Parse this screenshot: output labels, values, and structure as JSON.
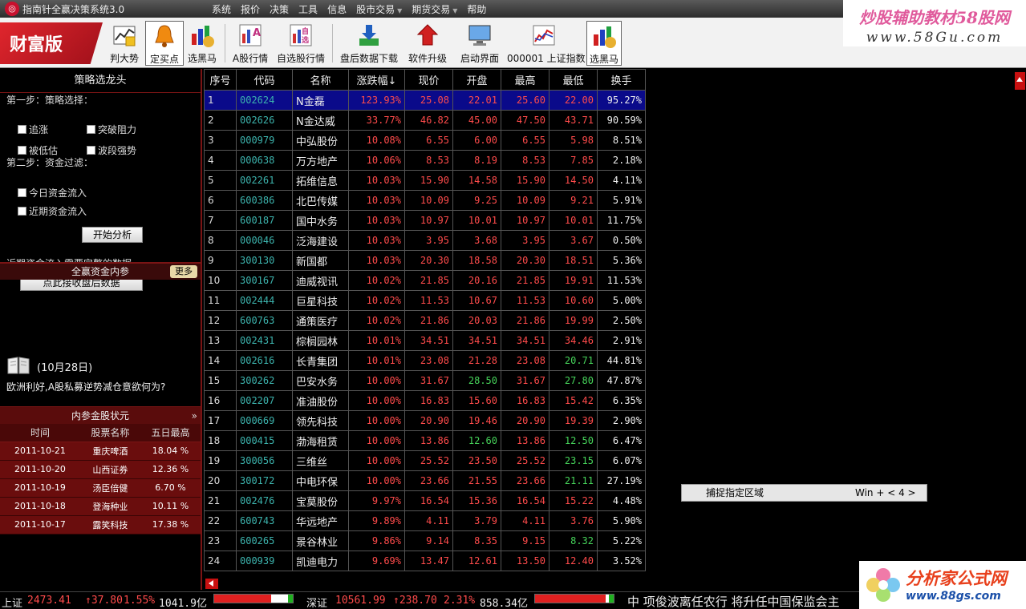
{
  "app": {
    "title": "指南针全赢决策系统3.0"
  },
  "menu": [
    {
      "label": "系统",
      "dropdown": false
    },
    {
      "label": "报价",
      "dropdown": false
    },
    {
      "label": "决策",
      "dropdown": false
    },
    {
      "label": "工具",
      "dropdown": false
    },
    {
      "label": "信息",
      "dropdown": false
    },
    {
      "label": "股市交易",
      "dropdown": true
    },
    {
      "label": "期货交易",
      "dropdown": true
    },
    {
      "label": "帮助",
      "dropdown": false
    }
  ],
  "watermark": {
    "line1": "炒股辅助教材58股网",
    "line2": "www.58Gu.com"
  },
  "edition": "财富版",
  "toolbar": [
    {
      "label": "判大势",
      "icon": "trend-icon",
      "active": false
    },
    {
      "label": "定买点",
      "icon": "bell-icon",
      "active": true
    },
    {
      "label": "选黑马",
      "icon": "bar-bag-icon",
      "active": false
    },
    {
      "label": "A股行情",
      "icon": "a-chart-icon",
      "active": false
    },
    {
      "label": "自选股行情",
      "icon": "custom-chart-icon",
      "active": false
    },
    {
      "label": "盘后数据下载",
      "icon": "download-icon",
      "active": false
    },
    {
      "label": "软件升级",
      "icon": "upgrade-icon",
      "active": false
    },
    {
      "label": "启动界面",
      "icon": "monitor-icon",
      "active": false
    },
    {
      "label": "000001 上证指数",
      "icon": "index-chart-icon",
      "active": false
    },
    {
      "label": "选黑马",
      "icon": "bar-bag-icon",
      "active": false
    }
  ],
  "strategy": {
    "title": "策略选龙头",
    "step1": "第一步：策略选择：",
    "options1": [
      "追涨",
      "突破阻力",
      "被低估",
      "波段强势"
    ],
    "step2": "第二步：资金过滤：",
    "options2": [
      "今日资金流入",
      "近期资金流入"
    ],
    "start_button": "开始分析",
    "note": "近期资金流入需要完整的数据",
    "receive_button": "点此接收盘后数据"
  },
  "insider": {
    "title": "全赢资金内参",
    "more": "更多",
    "date": "(10月28日)",
    "headline": "欧洲利好,A股私募逆势减仓意欲何为?"
  },
  "gold_stocks": {
    "title": "内参金股状元",
    "columns": [
      "时间",
      "股票名称",
      "五日最高"
    ],
    "rows": [
      [
        "2011-10-21",
        "重庆啤酒",
        "18.04 %"
      ],
      [
        "2011-10-20",
        "山西证券",
        "12.36 %"
      ],
      [
        "2011-10-19",
        "汤臣倍健",
        "6.70 %"
      ],
      [
        "2011-10-18",
        "登海种业",
        "10.11 %"
      ],
      [
        "2011-10-17",
        "露笑科技",
        "17.38 %"
      ]
    ]
  },
  "grid": {
    "columns": [
      "序号",
      "代码",
      "名称",
      "涨跌幅↓",
      "现价",
      "开盘",
      "最高",
      "最低",
      "换手"
    ],
    "rows": [
      {
        "seq": "1",
        "code": "002624",
        "name": "N金磊",
        "chg": "123.93%",
        "price": "25.08",
        "open": "22.01",
        "high": "25.60",
        "low": "22.00",
        "turn": "95.27%",
        "oc": "r",
        "lc": "r"
      },
      {
        "seq": "2",
        "code": "002626",
        "name": "N金达威",
        "chg": "33.77%",
        "price": "46.82",
        "open": "45.00",
        "high": "47.50",
        "low": "43.71",
        "turn": "90.59%",
        "oc": "r",
        "lc": "r"
      },
      {
        "seq": "3",
        "code": "000979",
        "name": "中弘股份",
        "chg": "10.08%",
        "price": "6.55",
        "open": "6.00",
        "high": "6.55",
        "low": "5.98",
        "turn": "8.51%",
        "oc": "r",
        "lc": "r"
      },
      {
        "seq": "4",
        "code": "000638",
        "name": "万方地产",
        "chg": "10.06%",
        "price": "8.53",
        "open": "8.19",
        "high": "8.53",
        "low": "7.85",
        "turn": "2.18%",
        "oc": "r",
        "lc": "r"
      },
      {
        "seq": "5",
        "code": "002261",
        "name": "拓维信息",
        "chg": "10.03%",
        "price": "15.90",
        "open": "14.58",
        "high": "15.90",
        "low": "14.50",
        "turn": "4.11%",
        "oc": "r",
        "lc": "r"
      },
      {
        "seq": "6",
        "code": "600386",
        "name": "北巴传媒",
        "chg": "10.03%",
        "price": "10.09",
        "open": "9.25",
        "high": "10.09",
        "low": "9.21",
        "turn": "5.91%",
        "oc": "r",
        "lc": "r"
      },
      {
        "seq": "7",
        "code": "600187",
        "name": "国中水务",
        "chg": "10.03%",
        "price": "10.97",
        "open": "10.01",
        "high": "10.97",
        "low": "10.01",
        "turn": "11.75%",
        "oc": "r",
        "lc": "r"
      },
      {
        "seq": "8",
        "code": "000046",
        "name": "泛海建设",
        "chg": "10.03%",
        "price": "3.95",
        "open": "3.68",
        "high": "3.95",
        "low": "3.67",
        "turn": "0.50%",
        "oc": "r",
        "lc": "r"
      },
      {
        "seq": "9",
        "code": "300130",
        "name": "新国都",
        "chg": "10.03%",
        "price": "20.30",
        "open": "18.58",
        "high": "20.30",
        "low": "18.51",
        "turn": "5.36%",
        "oc": "r",
        "lc": "r"
      },
      {
        "seq": "10",
        "code": "300167",
        "name": "迪威视讯",
        "chg": "10.02%",
        "price": "21.85",
        "open": "20.16",
        "high": "21.85",
        "low": "19.91",
        "turn": "11.53%",
        "oc": "r",
        "lc": "r"
      },
      {
        "seq": "11",
        "code": "002444",
        "name": "巨星科技",
        "chg": "10.02%",
        "price": "11.53",
        "open": "10.67",
        "high": "11.53",
        "low": "10.60",
        "turn": "5.00%",
        "oc": "r",
        "lc": "r"
      },
      {
        "seq": "12",
        "code": "600763",
        "name": "通策医疗",
        "chg": "10.02%",
        "price": "21.86",
        "open": "20.03",
        "high": "21.86",
        "low": "19.99",
        "turn": "2.50%",
        "oc": "r",
        "lc": "r"
      },
      {
        "seq": "13",
        "code": "002431",
        "name": "棕榈园林",
        "chg": "10.01%",
        "price": "34.51",
        "open": "34.51",
        "high": "34.51",
        "low": "34.46",
        "turn": "2.91%",
        "oc": "r",
        "lc": "r"
      },
      {
        "seq": "14",
        "code": "002616",
        "name": "长青集团",
        "chg": "10.01%",
        "price": "23.08",
        "open": "21.28",
        "high": "23.08",
        "low": "20.71",
        "turn": "44.81%",
        "oc": "r",
        "lc": "g"
      },
      {
        "seq": "15",
        "code": "300262",
        "name": "巴安水务",
        "chg": "10.00%",
        "price": "31.67",
        "open": "28.50",
        "high": "31.67",
        "low": "27.80",
        "turn": "47.87%",
        "oc": "g",
        "lc": "g"
      },
      {
        "seq": "16",
        "code": "002207",
        "name": "准油股份",
        "chg": "10.00%",
        "price": "16.83",
        "open": "15.60",
        "high": "16.83",
        "low": "15.42",
        "turn": "6.35%",
        "oc": "r",
        "lc": "r"
      },
      {
        "seq": "17",
        "code": "000669",
        "name": "领先科技",
        "chg": "10.00%",
        "price": "20.90",
        "open": "19.46",
        "high": "20.90",
        "low": "19.39",
        "turn": "2.90%",
        "oc": "r",
        "lc": "r"
      },
      {
        "seq": "18",
        "code": "000415",
        "name": "渤海租赁",
        "chg": "10.00%",
        "price": "13.86",
        "open": "12.60",
        "high": "13.86",
        "low": "12.50",
        "turn": "6.47%",
        "oc": "g",
        "lc": "g"
      },
      {
        "seq": "19",
        "code": "300056",
        "name": "三维丝",
        "chg": "10.00%",
        "price": "25.52",
        "open": "23.50",
        "high": "25.52",
        "low": "23.15",
        "turn": "6.07%",
        "oc": "r",
        "lc": "g"
      },
      {
        "seq": "20",
        "code": "300172",
        "name": "中电环保",
        "chg": "10.00%",
        "price": "23.66",
        "open": "21.55",
        "high": "23.66",
        "low": "21.11",
        "turn": "27.19%",
        "oc": "r",
        "lc": "g"
      },
      {
        "seq": "21",
        "code": "002476",
        "name": "宝莫股份",
        "chg": "9.97%",
        "price": "16.54",
        "open": "15.36",
        "high": "16.54",
        "low": "15.22",
        "turn": "4.48%",
        "oc": "r",
        "lc": "r"
      },
      {
        "seq": "22",
        "code": "600743",
        "name": "华远地产",
        "chg": "9.89%",
        "price": "4.11",
        "open": "3.79",
        "high": "4.11",
        "low": "3.76",
        "turn": "5.90%",
        "oc": "r",
        "lc": "r"
      },
      {
        "seq": "23",
        "code": "600265",
        "name": "景谷林业",
        "chg": "9.86%",
        "price": "9.14",
        "open": "8.35",
        "high": "9.15",
        "low": "8.32",
        "turn": "5.22%",
        "oc": "r",
        "lc": "g"
      },
      {
        "seq": "24",
        "code": "000939",
        "name": "凯迪电力",
        "chg": "9.69%",
        "price": "13.47",
        "open": "12.61",
        "high": "13.50",
        "low": "12.40",
        "turn": "3.52%",
        "oc": "r",
        "lc": "r"
      }
    ]
  },
  "capture_popup": {
    "label": "捕捉指定区域",
    "shortcut": "Win + < 4 >"
  },
  "status": {
    "sh_label": "上证",
    "sh_index": "2473.41",
    "sh_change": "↑37.80",
    "sh_pct": "1.55%",
    "sh_volume": "1041.9亿",
    "sh_bar": 0.72,
    "sz_label": "深证",
    "sz_index": "10561.99",
    "sz_change": "↑238.70",
    "sz_pct": "2.31%",
    "sz_volume": "858.34亿",
    "sz_bar": 0.9,
    "ticker": "中 项俊波离任农行 将升任中国保监会主"
  },
  "bottom_logo": {
    "line1": "分析家公式网",
    "line2": "www.88gs.com"
  },
  "colors": {
    "up": "#ff4b4b",
    "down": "#46d35a",
    "code": "#3cb3ad",
    "selected_row": "#0a0a8a",
    "panel_border": "#7a1414"
  }
}
